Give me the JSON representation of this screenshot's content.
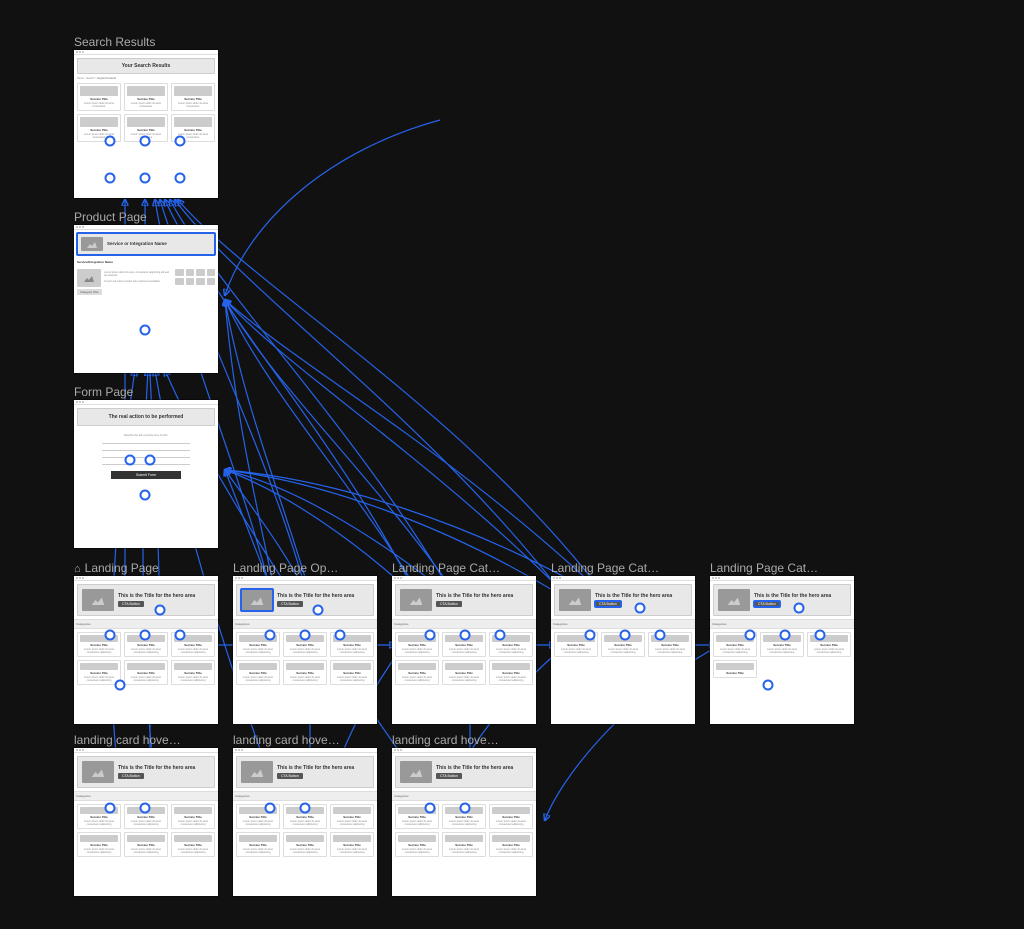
{
  "frames": {
    "search_results": {
      "label": "Search Results",
      "title": "Your Search Results",
      "card_title": "Service Title",
      "card_desc": "Lorem ipsum dolor sit amet consectetur"
    },
    "product_page": {
      "label": "Product Page",
      "title": "Service or Integration Name",
      "subtitle": "Service/Integration Name",
      "tag": "Category Title"
    },
    "form_page": {
      "label": "Form Page",
      "title": "The real action to be performed",
      "button": "Submit Form"
    },
    "landing_page": {
      "label": "Landing Page",
      "hero_title": "This is the Title for the hero area",
      "cta": "CTA Button",
      "section": "Categories",
      "card_title": "Service Title",
      "card_desc": "Lorem ipsum dolor sit amet consectetur adipiscing"
    },
    "landing_op": {
      "label": "Landing Page Op…"
    },
    "landing_cat1": {
      "label": "Landing Page Cat…"
    },
    "landing_cat2": {
      "label": "Landing Page Cat…"
    },
    "landing_cat3": {
      "label": "Landing Page Cat…"
    },
    "hover1": {
      "label": "landing card hove…"
    },
    "hover2": {
      "label": "landing card hove…"
    },
    "hover3": {
      "label": "landing card hove…"
    }
  }
}
